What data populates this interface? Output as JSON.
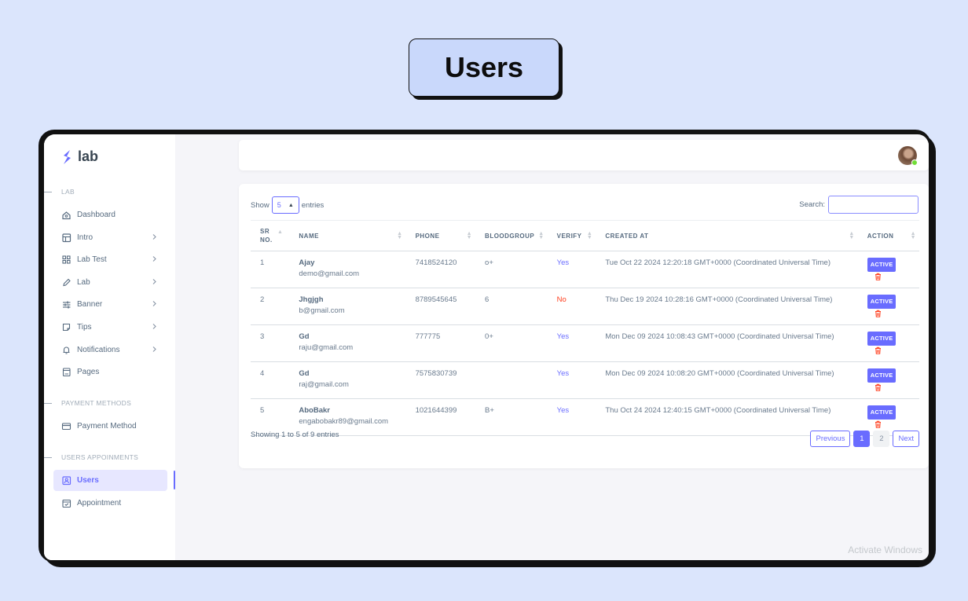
{
  "page": {
    "title": "Users"
  },
  "sidebar": {
    "brand": "lab",
    "sections": [
      {
        "label": "LAB",
        "items": [
          {
            "label": "Dashboard",
            "icon": "home-icon",
            "chevron": false
          },
          {
            "label": "Intro",
            "icon": "layout-icon",
            "chevron": true
          },
          {
            "label": "Lab Test",
            "icon": "grid-icon",
            "chevron": true
          },
          {
            "label": "Lab",
            "icon": "pencil-icon",
            "chevron": true
          },
          {
            "label": "Banner",
            "icon": "sliders-icon",
            "chevron": true
          },
          {
            "label": "Tips",
            "icon": "note-icon",
            "chevron": true
          },
          {
            "label": "Notifications",
            "icon": "bell-icon",
            "chevron": true
          },
          {
            "label": "Pages",
            "icon": "document-icon",
            "chevron": false
          }
        ]
      },
      {
        "label": "PAYMENT METHODS",
        "items": [
          {
            "label": "Payment Method",
            "icon": "card-icon",
            "chevron": false
          }
        ]
      },
      {
        "label": "USERS APPOINMENTS",
        "items": [
          {
            "label": "Users",
            "icon": "user-box-icon",
            "chevron": false,
            "active": true
          },
          {
            "label": "Appointment",
            "icon": "calendar-check-icon",
            "chevron": false
          }
        ]
      }
    ]
  },
  "table_controls": {
    "show_label": "Show",
    "entries_value": "5",
    "entries_label": "entries",
    "search_label": "Search:",
    "search_value": ""
  },
  "table": {
    "columns": [
      "SR NO.",
      "NAME",
      "PHONE",
      "BLOODGROUP",
      "VERIFY",
      "CREATED AT",
      "ACTION"
    ],
    "rows": [
      {
        "sr": "1",
        "name": "Ajay",
        "email": "demo@gmail.com",
        "phone": "7418524120",
        "blood": "o+",
        "verify": "Yes",
        "created": "Tue Oct 22 2024 12:20:18 GMT+0000 (Coordinated Universal Time)",
        "status": "ACTIVE"
      },
      {
        "sr": "2",
        "name": "Jhgjgh",
        "email": "b@gmail.com",
        "phone": "8789545645",
        "blood": "6",
        "verify": "No",
        "created": "Thu Dec 19 2024 10:28:16 GMT+0000 (Coordinated Universal Time)",
        "status": "ACTIVE"
      },
      {
        "sr": "3",
        "name": "Gd",
        "email": "raju@gmail.com",
        "phone": "777775",
        "blood": "0+",
        "verify": "Yes",
        "created": "Mon Dec 09 2024 10:08:43 GMT+0000 (Coordinated Universal Time)",
        "status": "ACTIVE"
      },
      {
        "sr": "4",
        "name": "Gd",
        "email": "raj@gmail.com",
        "phone": "7575830739",
        "blood": "",
        "verify": "Yes",
        "created": "Mon Dec 09 2024 10:08:20 GMT+0000 (Coordinated Universal Time)",
        "status": "ACTIVE"
      },
      {
        "sr": "5",
        "name": "AboBakr",
        "email": "engabobakr89@gmail.com",
        "phone": "1021644399",
        "blood": "B+",
        "verify": "Yes",
        "created": "Thu Oct 24 2024 12:40:15 GMT+0000 (Coordinated Universal Time)",
        "status": "ACTIVE"
      }
    ]
  },
  "footer": {
    "info": "Showing 1 to 5 of 9 entries",
    "previous": "Previous",
    "pages": [
      "1",
      "2"
    ],
    "next": "Next"
  },
  "watermark": "Activate Windows",
  "colors": {
    "accent": "#696cff",
    "danger": "#ff3e1d",
    "background": "#dbe5fc"
  }
}
